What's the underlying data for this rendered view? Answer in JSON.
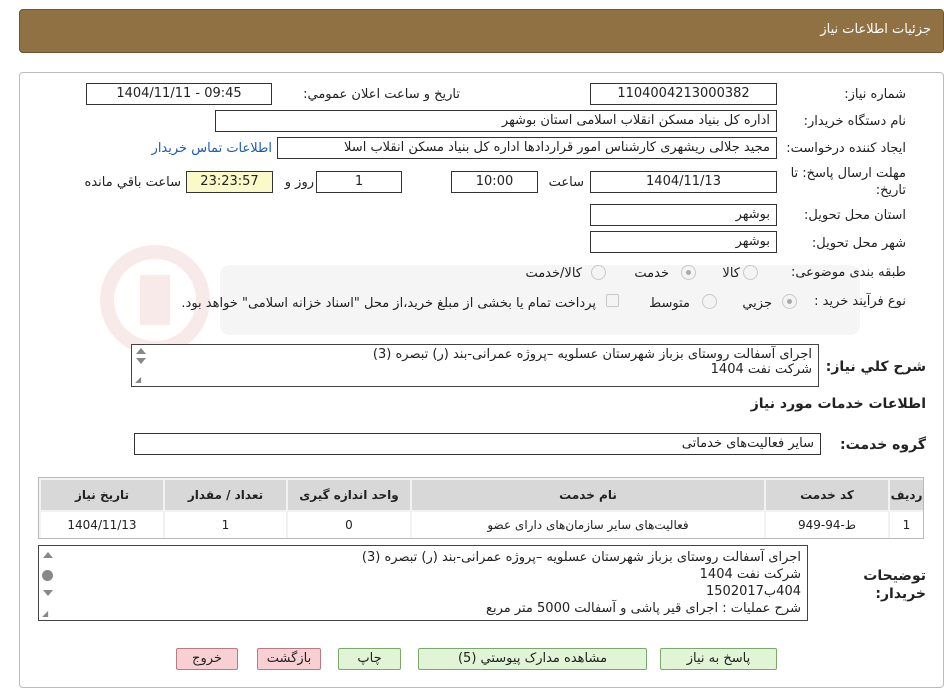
{
  "header": {
    "title": "جزئیات اطلاعات نیاز"
  },
  "fields": {
    "need_number_label": "شماره نياز:",
    "need_number": "1104004213000382",
    "announce_label": "تاريخ و ساعت اعلان عمومي:",
    "announce_value": "1404/11/11 - 09:45",
    "buyer_org_label": "نام دستگاه خريدار:",
    "buyer_org": "اداره کل بنياد مسکن انقلاب اسلامی استان بوشهر",
    "creator_label": "ايجاد کننده درخواست:",
    "creator": "مجید جلالی ریشهری کارشناس امور قراردادها اداره کل بنياد مسکن انقلاب اسلا",
    "contact_link": "اطلاعات تماس خريدار",
    "deadline_label": "مهلت ارسال پاسخ: تا",
    "deadline_label2": "تاريخ:",
    "deadline_date": "1404/11/13",
    "time_label": "ساعت",
    "deadline_time": "10:00",
    "days_value": "1",
    "days_label": "روز و",
    "remaining_time": "23:23:57",
    "remaining_label": "ساعت باقي مانده",
    "province_label": "استان محل تحويل:",
    "province": "بوشهر",
    "city_label": "شهر محل تحويل:",
    "city": "بوشهر",
    "category_label": "طبقه بندی موضوعی:",
    "category_options": [
      "کالا",
      "خدمت",
      "کالا/خدمت"
    ],
    "category_selected": "خدمت",
    "process_label": "نوع فرآيند خريد :",
    "process_options": [
      "جزيي",
      "متوسط"
    ],
    "process_selected": "جزيي",
    "payment_note": "پرداخت تمام يا بخشی از مبلغ خريد،از محل \"اسناد خزانه اسلامی\" خواهد بود."
  },
  "description": {
    "label": "شرح کلي نياز:",
    "lines": [
      "اجرای آسفالت روستای بزباز  شهرستان عسلویه –پروژه عمرانی-بند (ر) تبصره (3)",
      "شرکت نفت 1404"
    ]
  },
  "services_title": "اطلاعات خدمات مورد نياز",
  "service_group": {
    "label": "گروه خدمت:",
    "value": "ساير فعاليت‌های خدماتی"
  },
  "table": {
    "headers": [
      "رديف",
      "کد خدمت",
      "نام خدمت",
      "واحد اندازه گيری",
      "تعداد / مقدار",
      "تاريخ نياز"
    ],
    "rows": [
      [
        "1",
        "ط-94-949",
        "فعاليت‌های ساير سازمان‌های دارای عضو",
        "0",
        "1",
        "1404/11/13"
      ]
    ]
  },
  "buyer_notes": {
    "label1": "توضيحات",
    "label2": "خريدار:",
    "lines": [
      "اجرای آسفالت روستای بزباز  شهرستان عسلویه –پروژه عمرانی-بند (ر) تبصره (3)",
      "شرکت نفت 1404",
      "404ب1502017",
      "شرح عملیات : اجرای قیر پاشی و آسفالت 5000 متر مربع"
    ]
  },
  "buttons": {
    "reply": "پاسخ به نياز",
    "attachments": "مشاهده مدارک پيوستي (5)",
    "print": "چاپ",
    "back": "بازگشت",
    "exit": "خروج"
  },
  "colors": {
    "header": "#8f7144",
    "link": "#1a5bb8",
    "highlight": "#fafac8",
    "green_button": "#dff5d6",
    "pink_button": "#f8d0d4"
  }
}
